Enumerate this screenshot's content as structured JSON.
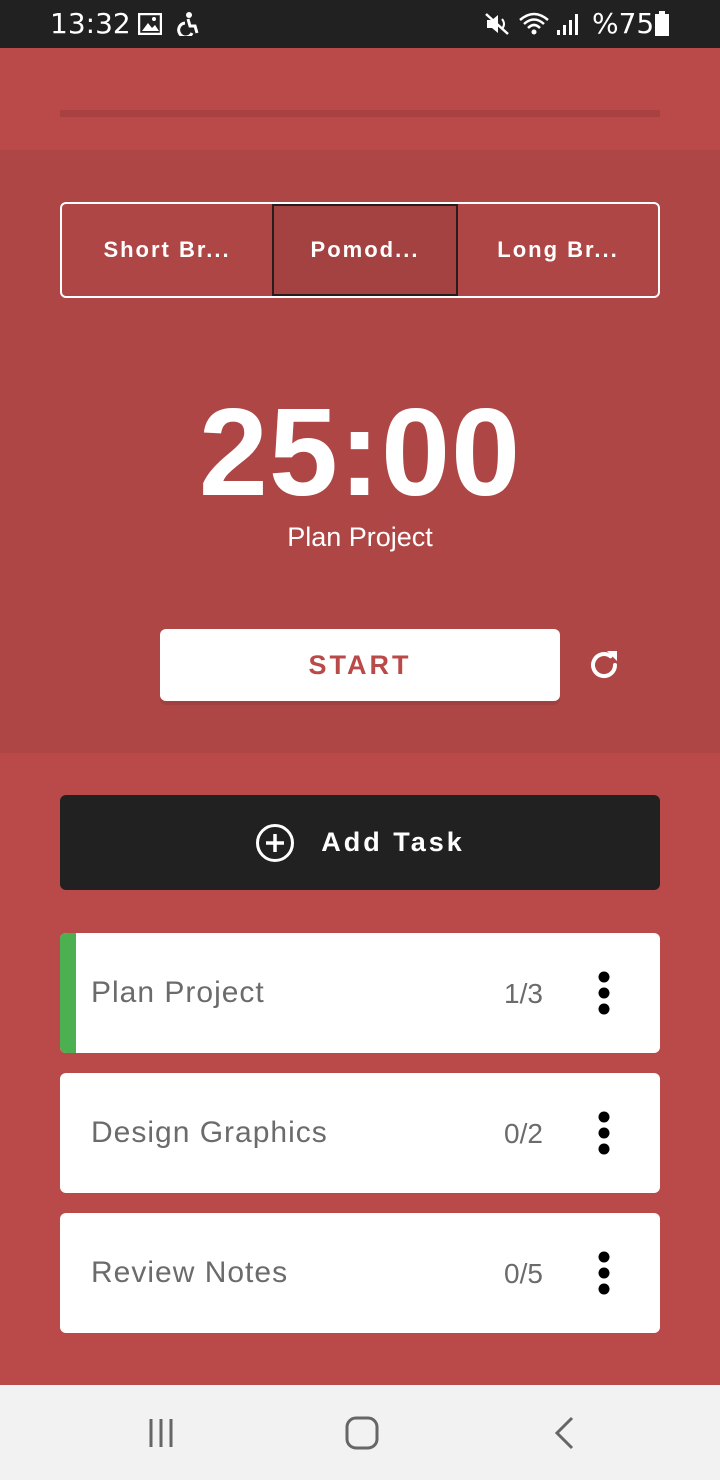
{
  "status_bar": {
    "time": "13:32",
    "battery_percent": "%75",
    "icons": [
      "image-icon",
      "accessibility-icon",
      "mute-icon",
      "wifi-icon",
      "signal-icon",
      "battery-icon"
    ]
  },
  "progress": {
    "fraction": 0
  },
  "mode_tabs": [
    {
      "label": "Short Br...",
      "selected": false
    },
    {
      "label": "Pomod...",
      "selected": true
    },
    {
      "label": "Long Br...",
      "selected": false
    }
  ],
  "timer": {
    "time": "25:00",
    "current_task": "Plan Project"
  },
  "controls": {
    "start_label": "START",
    "reset_icon": "refresh-icon"
  },
  "add_task": {
    "label": "Add Task",
    "icon": "plus-circle-icon"
  },
  "tasks": [
    {
      "title": "Plan Project",
      "count": "1/3",
      "active": true
    },
    {
      "title": "Design Graphics",
      "count": "0/2",
      "active": false
    },
    {
      "title": "Review Notes",
      "count": "0/5",
      "active": false
    }
  ],
  "colors": {
    "background": "#ba4949",
    "panel": "#af4646",
    "active_task": "#4caf50",
    "dark_button": "#212121"
  },
  "nav_bar": {
    "icons": [
      "recent-apps-icon",
      "home-icon",
      "back-icon"
    ]
  }
}
